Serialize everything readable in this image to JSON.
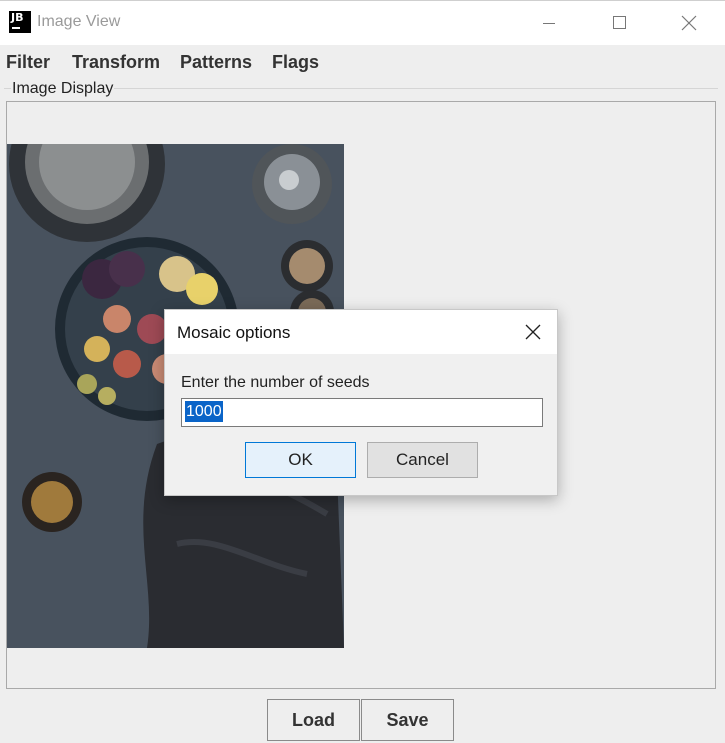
{
  "window": {
    "logo_text": "JB",
    "title": "Image View"
  },
  "menu": {
    "items": [
      {
        "label": "Filter"
      },
      {
        "label": "Transform"
      },
      {
        "label": "Patterns"
      },
      {
        "label": "Flags"
      }
    ]
  },
  "panel": {
    "label": "Image Display"
  },
  "buttons": {
    "load": "Load",
    "save": "Save"
  },
  "dialog": {
    "title": "Mosaic options",
    "prompt": "Enter the number of seeds",
    "input_value": "1000",
    "ok": "OK",
    "cancel": "Cancel"
  },
  "colors": {
    "selection": "#0a64c8",
    "ok_border": "#0078d7",
    "ok_bg": "#e5f1fb"
  }
}
